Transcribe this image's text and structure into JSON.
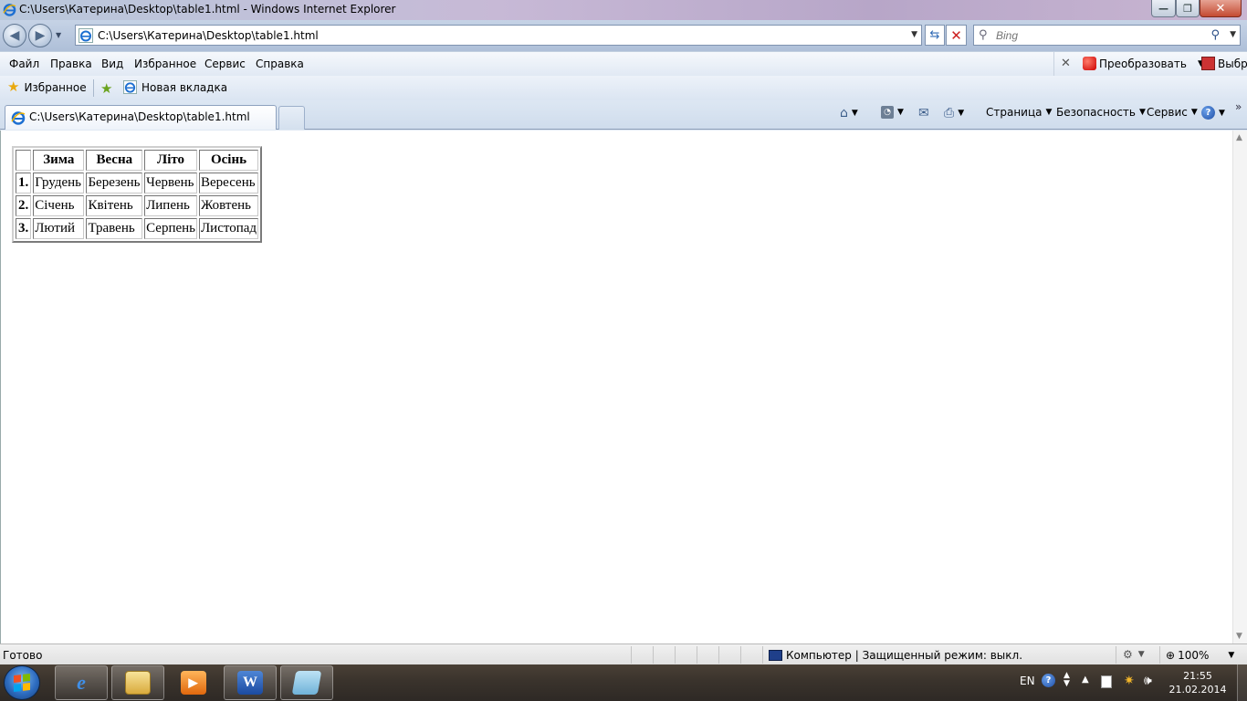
{
  "window": {
    "title": "C:\\Users\\Катерина\\Desktop\\table1.html - Windows Internet Explorer"
  },
  "address_bar": {
    "url": "C:\\Users\\Катерина\\Desktop\\table1.html"
  },
  "search": {
    "placeholder": "Bing"
  },
  "menu": {
    "items": [
      "Файл",
      "Правка",
      "Вид",
      "Избранное",
      "Сервис",
      "Справка"
    ],
    "convert_label": "Преобразовать",
    "select_label": "Выбр"
  },
  "favorites_bar": {
    "favorites_label": "Избранное",
    "new_tab_label": "Новая вкладка"
  },
  "tabs": [
    {
      "label": "C:\\Users\\Катерина\\Desktop\\table1.html"
    }
  ],
  "command_bar": {
    "page_label": "Страница",
    "safety_label": "Безопасность",
    "service_label": "Сервис",
    "more_label": "»"
  },
  "page_table": {
    "headers": [
      "",
      "Зима",
      "Весна",
      "Літо",
      "Осінь"
    ],
    "rows": [
      [
        "1.",
        "Грудень",
        "Березень",
        "Червень",
        "Вересень"
      ],
      [
        "2.",
        "Січень",
        "Квітень",
        "Липень",
        "Жовтень"
      ],
      [
        "3.",
        "Лютий",
        "Травень",
        "Серпень",
        "Листопад"
      ]
    ]
  },
  "status_bar": {
    "status": "Готово",
    "zone": "Компьютер | Защищенный режим: выкл.",
    "zoom": "100%"
  },
  "taskbar": {
    "language": "EN",
    "time": "21:55",
    "date": "21.02.2014"
  },
  "colors": {
    "close_button": "#c44a31",
    "title_gradient_start": "#b9c9dc",
    "taskbar": "#3a332c"
  }
}
